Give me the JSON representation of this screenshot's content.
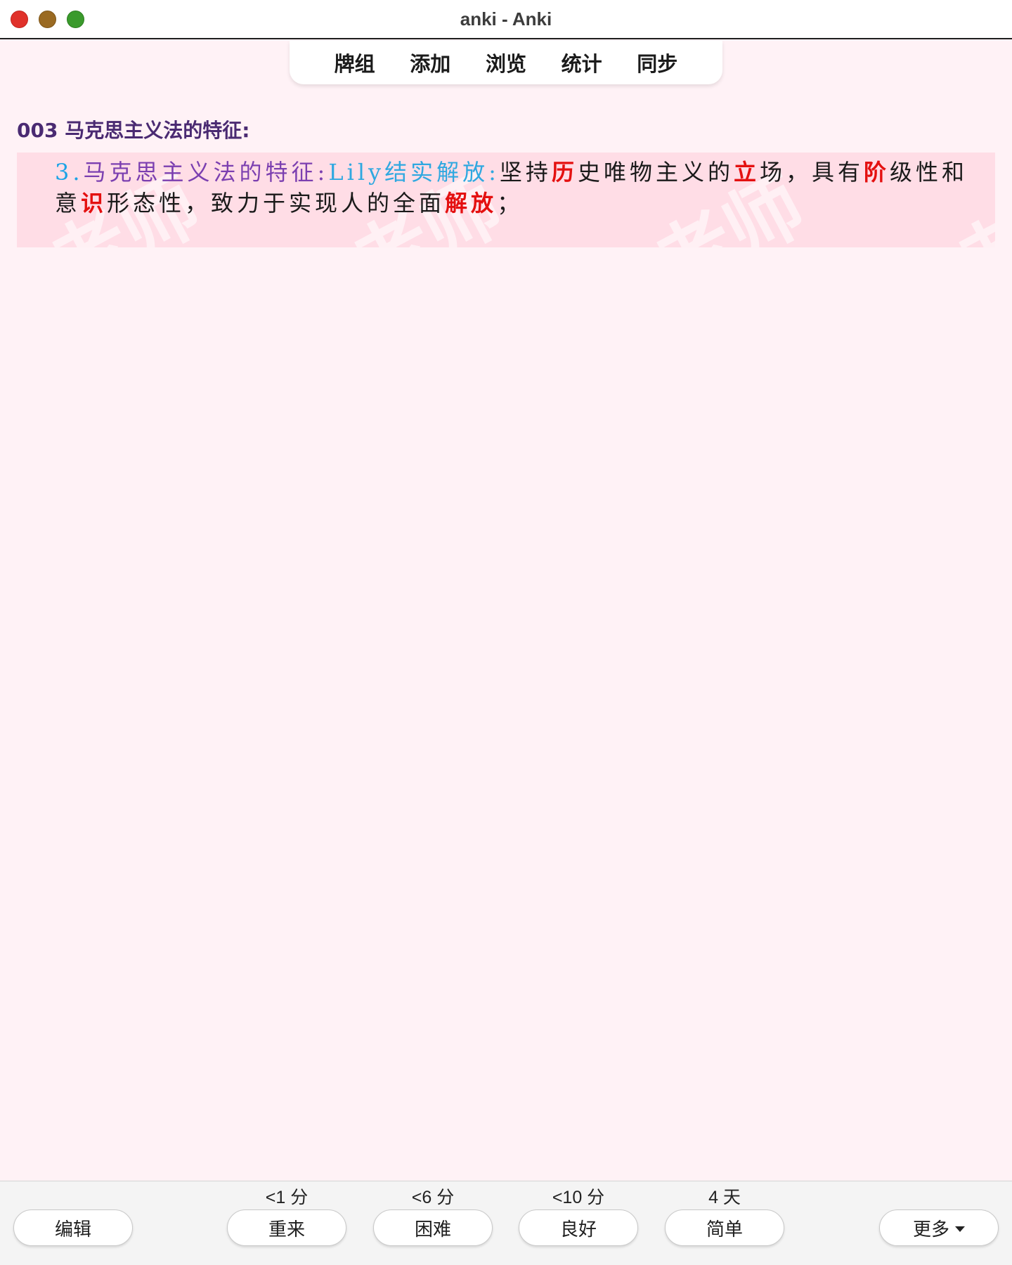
{
  "window": {
    "title": "anki - Anki"
  },
  "toolbar": {
    "items": [
      "牌组",
      "添加",
      "浏览",
      "统计",
      "同步"
    ]
  },
  "deck": {
    "title": "003 马克思主义法的特征:"
  },
  "card": {
    "watermark": "老师",
    "segments": [
      {
        "text": "3.",
        "style": "num"
      },
      {
        "text": "马克思主义法的特征:",
        "style": "pur"
      },
      {
        "text": "Lily结实解放:",
        "style": "cyan"
      },
      {
        "text": "坚持",
        "style": "plain"
      },
      {
        "text": "历",
        "style": "red"
      },
      {
        "text": "史唯物主义的",
        "style": "plain"
      },
      {
        "text": "立",
        "style": "red"
      },
      {
        "text": "场，具有",
        "style": "plain"
      },
      {
        "text": "阶",
        "style": "red"
      },
      {
        "text": "级性和意",
        "style": "plain"
      },
      {
        "text": "识",
        "style": "red"
      },
      {
        "text": "形态性，致力于实现人的全面",
        "style": "plain"
      },
      {
        "text": "解放",
        "style": "red"
      },
      {
        "text": "；",
        "style": "plain"
      }
    ]
  },
  "bottom": {
    "edit_label": "编辑",
    "more_label": "更多",
    "answers": [
      {
        "interval": "<1 分",
        "label": "重来"
      },
      {
        "interval": "<6 分",
        "label": "困难"
      },
      {
        "interval": "<10 分",
        "label": "良好"
      },
      {
        "interval": "4 天",
        "label": "简单"
      }
    ]
  }
}
